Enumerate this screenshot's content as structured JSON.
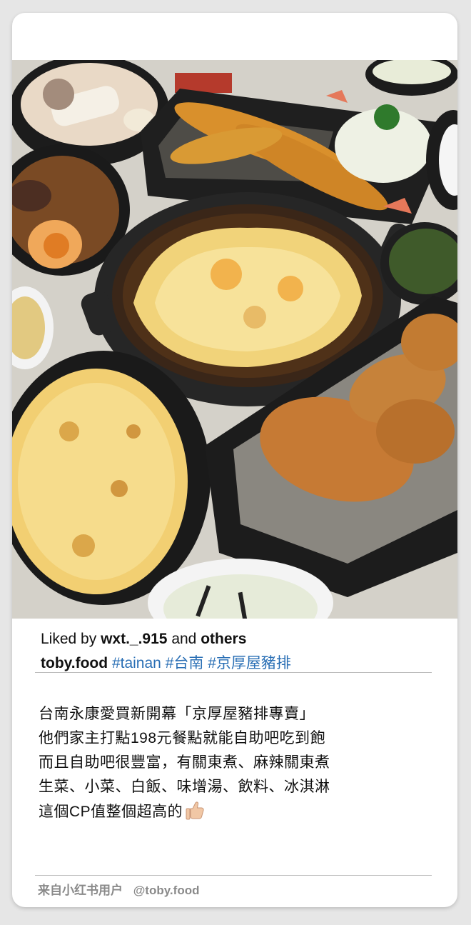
{
  "post": {
    "liked_prefix": "Liked by",
    "liked_user": "wxt._.915",
    "liked_and": "and",
    "liked_others": "others",
    "username": "toby.food",
    "hashtags": [
      "#tainan",
      "#台南",
      "#京厚屋豬排"
    ]
  },
  "body": {
    "lines": [
      "台南永康愛買新開幕「京厚屋豬排專賣」",
      "他們家主打點198元餐點就能自助吧吃到飽",
      "而且自助吧很豐富，有關東煮、麻辣關東煮",
      "生菜、小菜、白飯、味增湯、飲料、冰淇淋",
      "這個CP值整個超高的"
    ],
    "emoji_icon": "thumbs-up-icon"
  },
  "footer": {
    "source": "来自小红书用户",
    "handle": "@toby.food"
  },
  "colors": {
    "hashtag": "#2a6fb5",
    "footer_text": "#8a8a8a"
  }
}
